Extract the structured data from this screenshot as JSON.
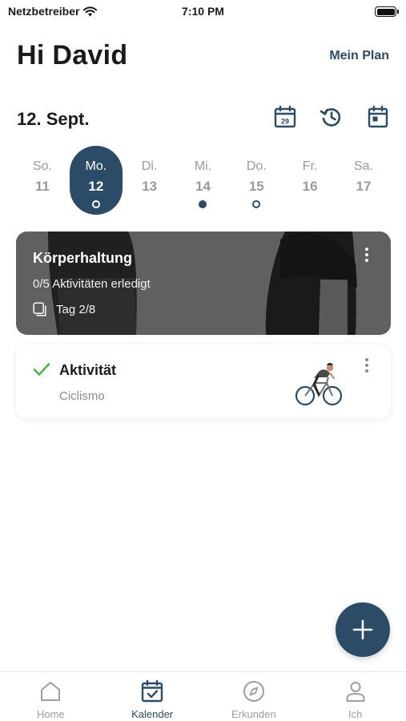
{
  "status_bar": {
    "carrier": "Netzbetreiber",
    "time": "7:10 PM"
  },
  "header": {
    "greeting": "Hi David",
    "plan_link": "Mein Plan"
  },
  "date_bar": {
    "date": "12. Sept.",
    "calendar_day_badge": "29"
  },
  "week": [
    {
      "name": "So.",
      "num": "11",
      "marker": "none",
      "selected": false
    },
    {
      "name": "Mo.",
      "num": "12",
      "marker": "ring",
      "selected": true
    },
    {
      "name": "Di.",
      "num": "13",
      "marker": "none",
      "selected": false
    },
    {
      "name": "Mi.",
      "num": "14",
      "marker": "filled",
      "selected": false
    },
    {
      "name": "Do.",
      "num": "15",
      "marker": "ring",
      "selected": false
    },
    {
      "name": "Fr.",
      "num": "16",
      "marker": "none",
      "selected": false
    },
    {
      "name": "Sa.",
      "num": "17",
      "marker": "none",
      "selected": false
    }
  ],
  "plan_card": {
    "title": "Körperhaltung",
    "progress": "0/5 Aktivitäten erledigt",
    "day": "Tag 2/8"
  },
  "activity_card": {
    "title": "Aktivität",
    "subtitle": "Ciclismo",
    "status_icon": "check-icon"
  },
  "tabs": [
    {
      "label": "Home",
      "icon": "home-icon",
      "active": false
    },
    {
      "label": "Kalender",
      "icon": "calendar-check-icon",
      "active": true
    },
    {
      "label": "Erkunden",
      "icon": "compass-icon",
      "active": false
    },
    {
      "label": "Ich",
      "icon": "person-icon",
      "active": false
    }
  ],
  "colors": {
    "primary": "#2c4b66",
    "check": "#4caf50",
    "muted": "#9a9a9a"
  }
}
